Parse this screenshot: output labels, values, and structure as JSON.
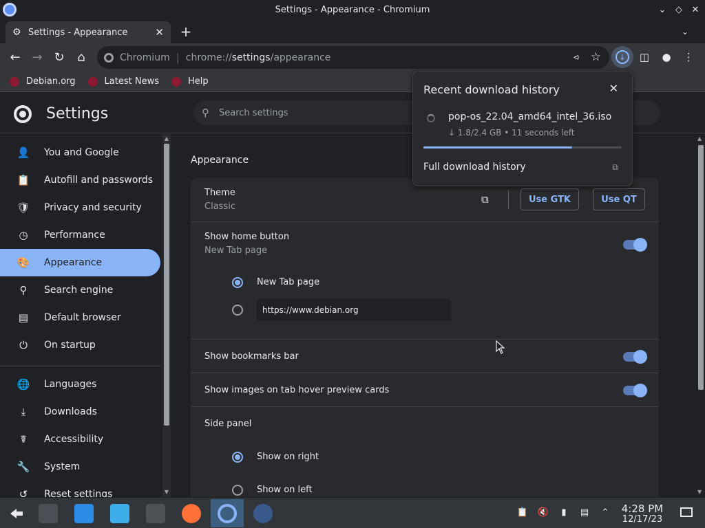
{
  "window": {
    "title": "Settings - Appearance - Chromium"
  },
  "tabs": [
    {
      "label": "Settings - Appearance",
      "icon": "gear-icon",
      "active": true
    }
  ],
  "toolbar": {
    "omnibox_chip": "Chromium",
    "url_prefix": "chrome://",
    "url_host": "settings",
    "url_path": "/appearance"
  },
  "bookmarks": [
    {
      "label": "Debian.org"
    },
    {
      "label": "Latest News"
    },
    {
      "label": "Help"
    }
  ],
  "settings": {
    "title": "Settings",
    "search_placeholder": "Search settings"
  },
  "sidebar": {
    "items": [
      {
        "label": "You and Google",
        "icon": "person-icon"
      },
      {
        "label": "Autofill and passwords",
        "icon": "clipboard-icon"
      },
      {
        "label": "Privacy and security",
        "icon": "shield-icon"
      },
      {
        "label": "Performance",
        "icon": "gauge-icon"
      },
      {
        "label": "Appearance",
        "icon": "palette-icon",
        "active": true
      },
      {
        "label": "Search engine",
        "icon": "search-icon"
      },
      {
        "label": "Default browser",
        "icon": "browser-icon"
      },
      {
        "label": "On startup",
        "icon": "power-icon"
      },
      {
        "label": "Languages",
        "icon": "globe-icon"
      },
      {
        "label": "Downloads",
        "icon": "download-icon"
      },
      {
        "label": "Accessibility",
        "icon": "accessibility-icon"
      },
      {
        "label": "System",
        "icon": "wrench-icon"
      },
      {
        "label": "Reset settings",
        "icon": "reset-icon"
      }
    ]
  },
  "appearance": {
    "section_title": "Appearance",
    "theme": {
      "label": "Theme",
      "value": "Classic",
      "btn_gtk": "Use GTK",
      "btn_qt": "Use QT"
    },
    "home_button": {
      "label": "Show home button",
      "sub": "New Tab page",
      "enabled": true,
      "options": [
        {
          "label": "New Tab page",
          "selected": true
        },
        {
          "value": "https://www.debian.org",
          "selected": false
        }
      ]
    },
    "bookmarks_bar": {
      "label": "Show bookmarks bar",
      "enabled": true
    },
    "tab_hover": {
      "label": "Show images on tab hover preview cards",
      "enabled": true
    },
    "side_panel": {
      "label": "Side panel",
      "options": [
        {
          "label": "Show on right",
          "selected": true
        },
        {
          "label": "Show on left",
          "selected": false
        }
      ]
    }
  },
  "download_popup": {
    "title": "Recent download history",
    "filename": "pop-os_22.04_amd64_intel_36.iso",
    "status": "↓ 1.8/2.4 GB • 11 seconds left",
    "progress": 0.75,
    "full_history": "Full download history"
  },
  "taskbar": {
    "apps": [
      {
        "name": "app-launcher"
      },
      {
        "name": "system-settings"
      },
      {
        "name": "discover-store"
      },
      {
        "name": "file-manager"
      },
      {
        "name": "terminal"
      },
      {
        "name": "firefox"
      },
      {
        "name": "chromium",
        "active": true
      },
      {
        "name": "network-app"
      }
    ],
    "time": "4:28 PM",
    "date": "12/17/23"
  }
}
